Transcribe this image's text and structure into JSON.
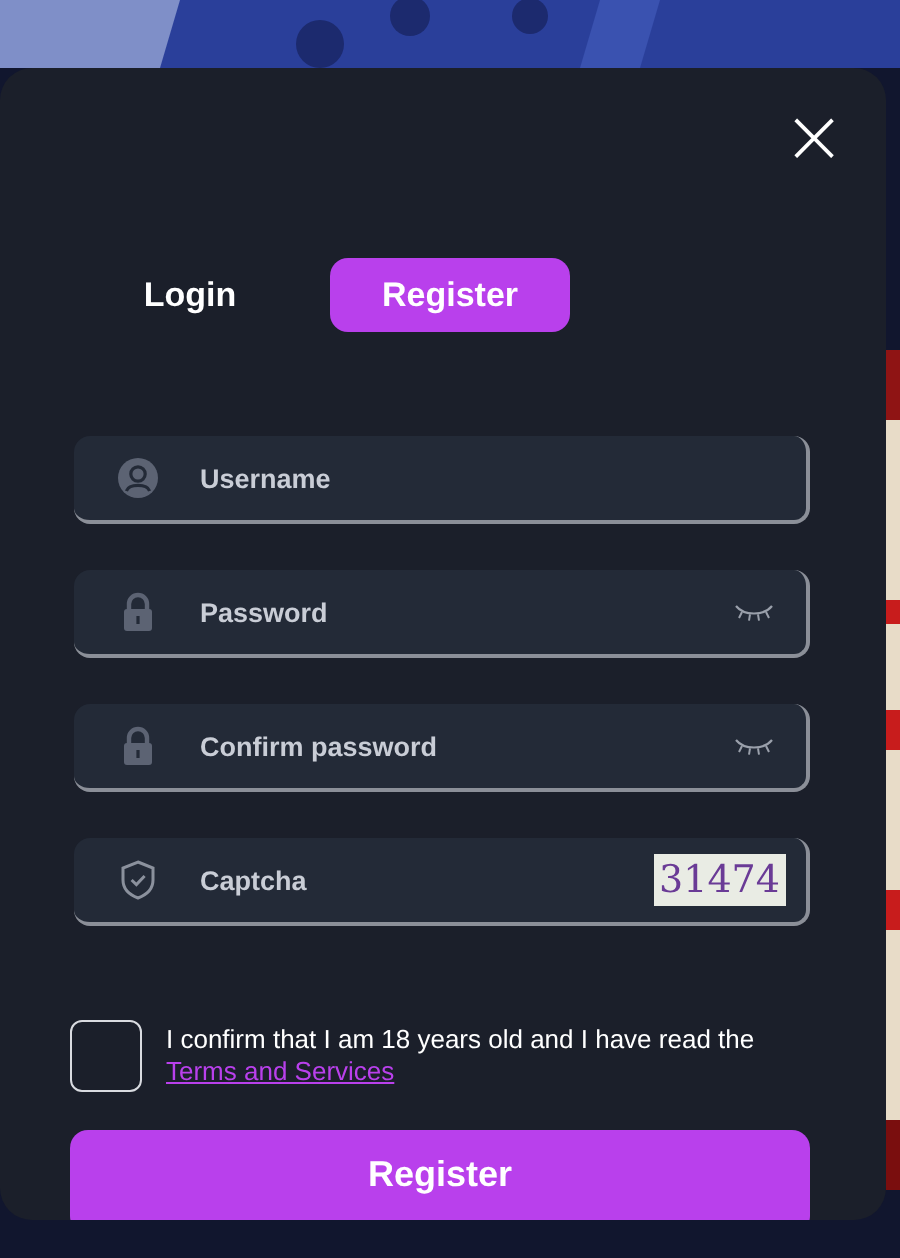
{
  "dialog": {
    "close": "×",
    "tabs": [
      {
        "label": "Login",
        "selected": false
      },
      {
        "label": "Register",
        "selected": true
      }
    ],
    "fields": [
      {
        "kind": "user",
        "placeholder": "Username"
      },
      {
        "kind": "password",
        "placeholder": "Password"
      },
      {
        "kind": "password",
        "placeholder": "Confirm password"
      },
      {
        "kind": "captcha",
        "placeholder": "Captcha",
        "captcha": "31474"
      }
    ],
    "consent": {
      "checked": false,
      "text": "I confirm that I am 18 years old and I have read the",
      "link": "Terms and Services"
    },
    "submit": "Register"
  }
}
